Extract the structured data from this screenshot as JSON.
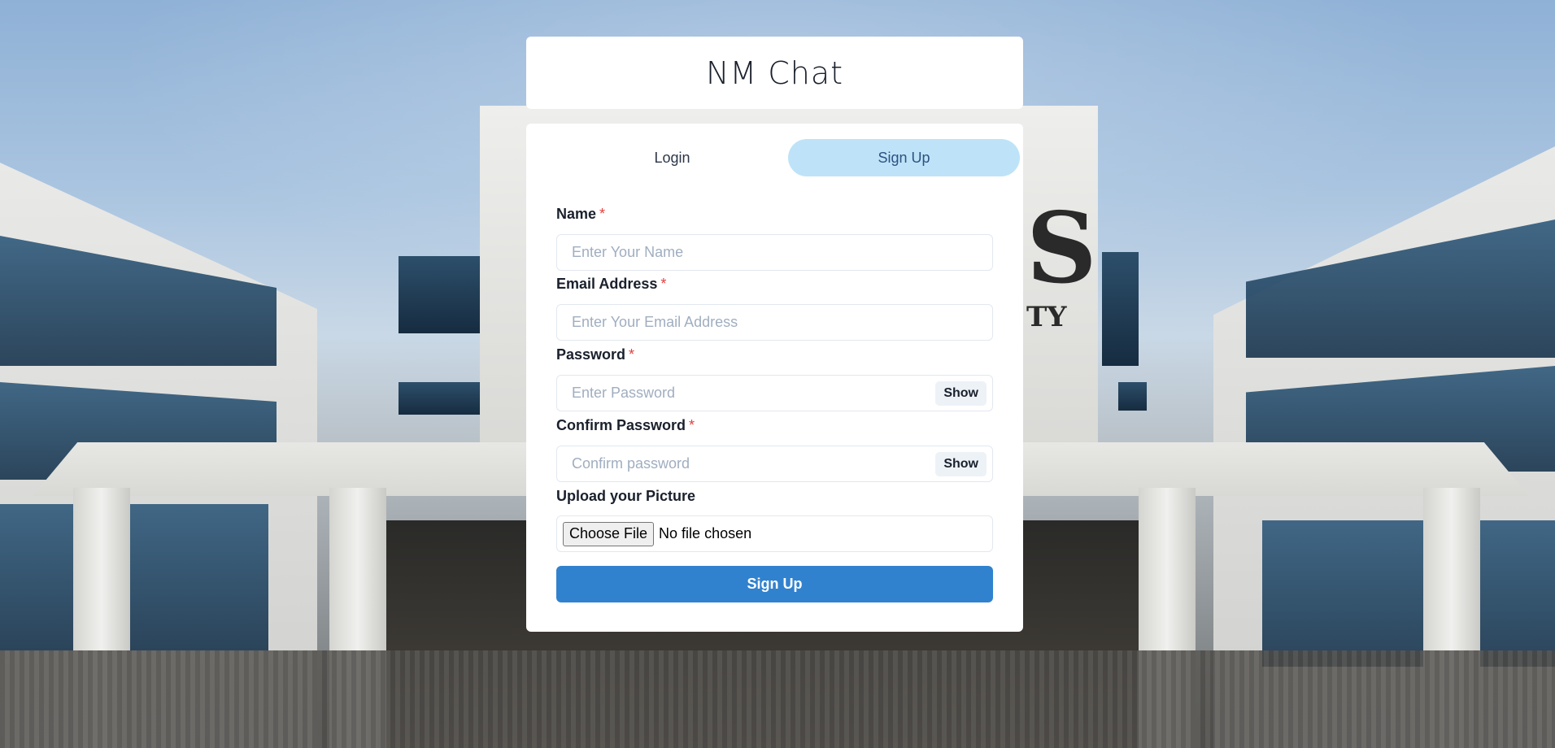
{
  "app": {
    "title": "NM Chat"
  },
  "tabs": [
    {
      "label": "Login",
      "active": false
    },
    {
      "label": "Sign Up",
      "active": true
    }
  ],
  "form": {
    "name": {
      "label": "Name",
      "required_mark": "*",
      "placeholder": "Enter Your Name",
      "value": ""
    },
    "email": {
      "label": "Email Address",
      "required_mark": "*",
      "placeholder": "Enter Your Email Address",
      "value": ""
    },
    "password": {
      "label": "Password",
      "required_mark": "*",
      "placeholder": "Enter Password",
      "value": "",
      "toggle_label": "Show"
    },
    "confirm_password": {
      "label": "Confirm Password",
      "required_mark": "*",
      "placeholder": "Confirm password",
      "value": "",
      "toggle_label": "Show"
    },
    "picture": {
      "label": "Upload your Picture",
      "button_label": "Choose File",
      "status": "No file chosen"
    },
    "submit_label": "Sign Up"
  },
  "colors": {
    "tab_active_bg": "#bee3f8",
    "submit_bg": "#3182ce",
    "required": "#e53e3e"
  }
}
